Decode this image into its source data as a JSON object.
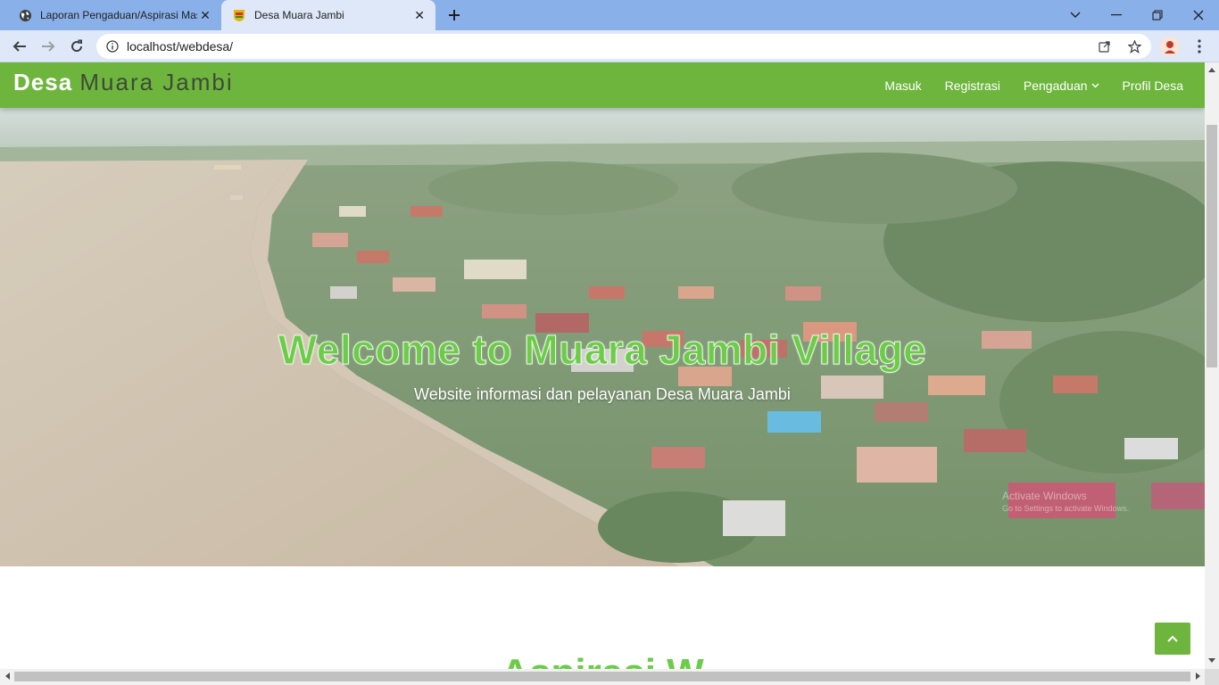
{
  "browser": {
    "tabs": [
      {
        "title": "Laporan Pengaduan/Aspirasi Masyarakat",
        "icon": "globe-icon",
        "active": false
      },
      {
        "title": "Desa Muara Jambi",
        "icon": "site-logo-icon",
        "active": true
      }
    ],
    "url": "localhost/webdesa/"
  },
  "site": {
    "brand_bold": "Desa",
    "brand_rest": "Muara Jambi",
    "nav": {
      "login": "Masuk",
      "register": "Registrasi",
      "complaints": "Pengaduan",
      "profile": "Profil Desa"
    },
    "hero": {
      "title": "Welcome to Muara Jambi Village",
      "subtitle": "Website informasi dan pelayanan Desa Muara Jambi"
    },
    "section_heading_partial": "Aspirasi W",
    "watermark": {
      "line1": "Activate Windows",
      "line2": "Go to Settings to activate Windows."
    }
  },
  "colors": {
    "navbar": "#6eb53d",
    "accent_text": "#6ccc4a",
    "tabstrip": "#8ab0e9",
    "toolbar": "#dfe8f8"
  }
}
